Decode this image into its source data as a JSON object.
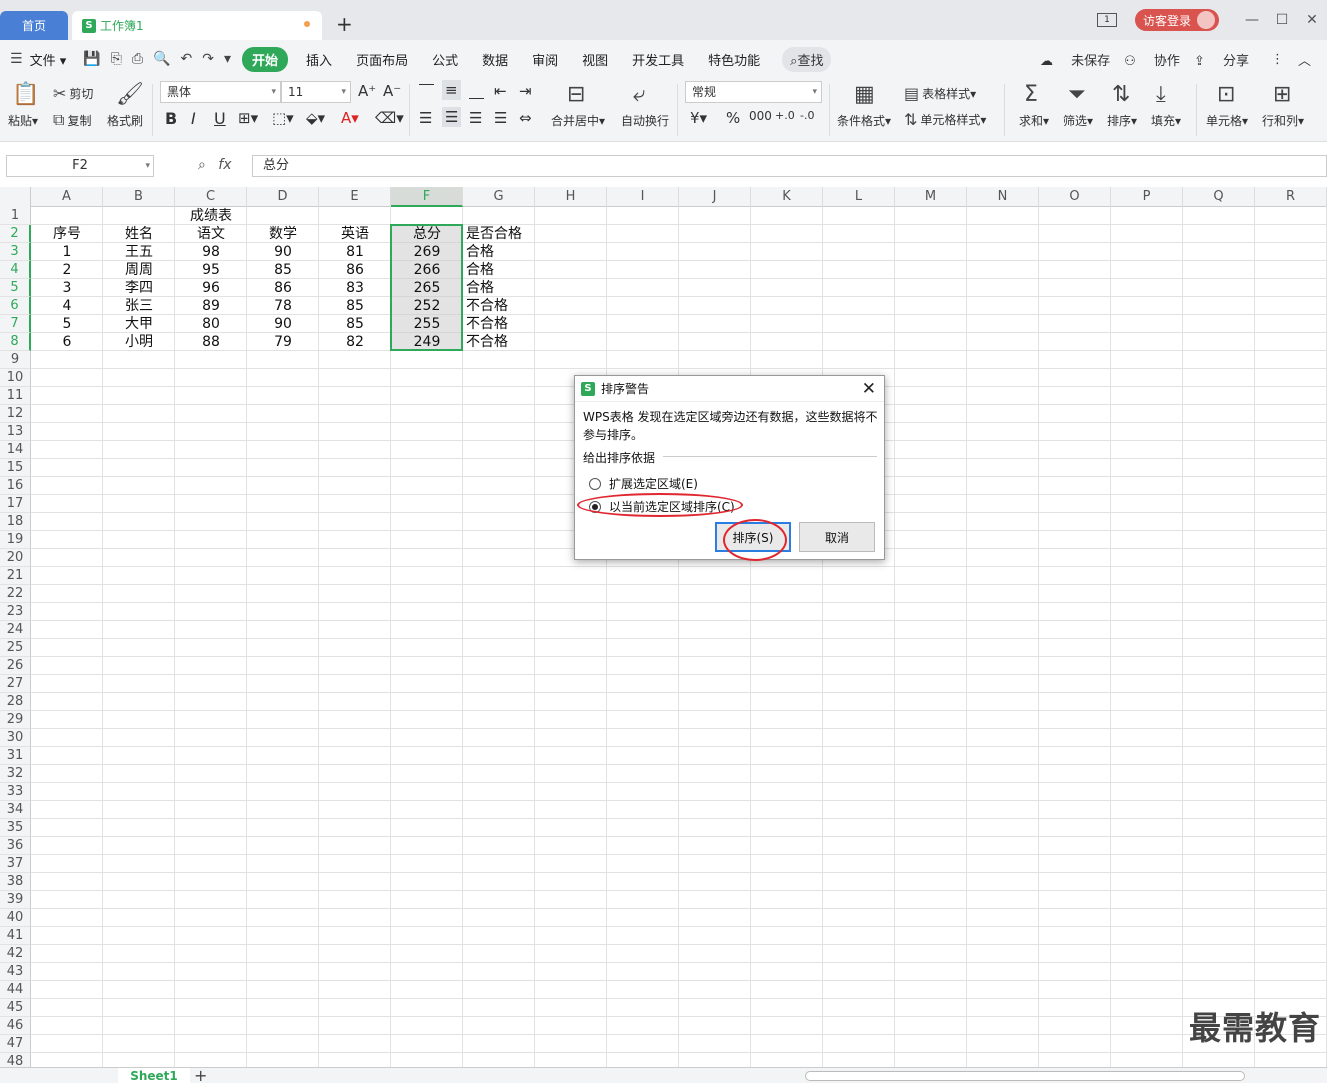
{
  "tabs": {
    "home": "首页",
    "document": "工作簿1",
    "new_tab": "+"
  },
  "title_bar": {
    "page_counter": "1",
    "login": "访客登录"
  },
  "menu": {
    "file": "文件",
    "items": [
      "开始",
      "插入",
      "页面布局",
      "公式",
      "数据",
      "审阅",
      "视图",
      "开发工具",
      "特色功能"
    ],
    "active": "开始",
    "search": "查找",
    "unsaved": "未保存",
    "collaborate": "协作",
    "share": "分享"
  },
  "ribbon": {
    "paste": "粘贴",
    "cut": "剪切",
    "copy": "复制",
    "format_painter": "格式刷",
    "font_name": "黑体",
    "font_size": "11",
    "merge_center": "合并居中",
    "wrap_text": "自动换行",
    "number_format": "常规",
    "conditional_format": "条件格式",
    "table_style": "表格样式",
    "cell_style": "单元格样式",
    "sum": "求和",
    "filter": "筛选",
    "sort": "排序",
    "fill": "填充",
    "cell": "单元格",
    "row_col": "行和列"
  },
  "formula_bar": {
    "cell_ref": "F2",
    "fx": "fx",
    "content": "总分"
  },
  "sheet": {
    "columns": [
      "A",
      "B",
      "C",
      "D",
      "E",
      "F",
      "G",
      "H",
      "I",
      "J",
      "K",
      "L",
      "M",
      "N",
      "O",
      "P",
      "Q",
      "R"
    ],
    "selected_column": "F",
    "selected_rows": [
      2,
      3,
      4,
      5,
      6,
      7,
      8
    ],
    "row_count": 48,
    "title": "成绩表",
    "headers": [
      "序号",
      "姓名",
      "语文",
      "数学",
      "英语",
      "总分",
      "是否合格"
    ],
    "rows": [
      [
        "1",
        "王五",
        "98",
        "90",
        "81",
        "269",
        "合格"
      ],
      [
        "2",
        "周周",
        "95",
        "85",
        "86",
        "266",
        "合格"
      ],
      [
        "3",
        "李四",
        "96",
        "86",
        "83",
        "265",
        "合格"
      ],
      [
        "4",
        "张三",
        "89",
        "78",
        "85",
        "252",
        "不合格"
      ],
      [
        "5",
        "大甲",
        "80",
        "90",
        "85",
        "255",
        "不合格"
      ],
      [
        "6",
        "小明",
        "88",
        "79",
        "82",
        "249",
        "不合格"
      ]
    ]
  },
  "sheet_tabs": {
    "active": "Sheet1",
    "add": "+"
  },
  "dialog": {
    "title": "排序警告",
    "message": "WPS表格 发现在选定区域旁边还有数据，这些数据将不参与排序。",
    "group_label": "给出排序依据",
    "option_expand": "扩展选定区域(E)",
    "option_current": "以当前选定区域排序(C)",
    "selected_option": "current",
    "sort_button": "排序(S)",
    "cancel_button": "取消"
  },
  "watermark": "最需教育",
  "colors": {
    "accent_green": "#2fa85a",
    "home_tab_blue": "#4a7fd6",
    "highlight_red": "#e0262f",
    "login_red": "#d9534f"
  }
}
